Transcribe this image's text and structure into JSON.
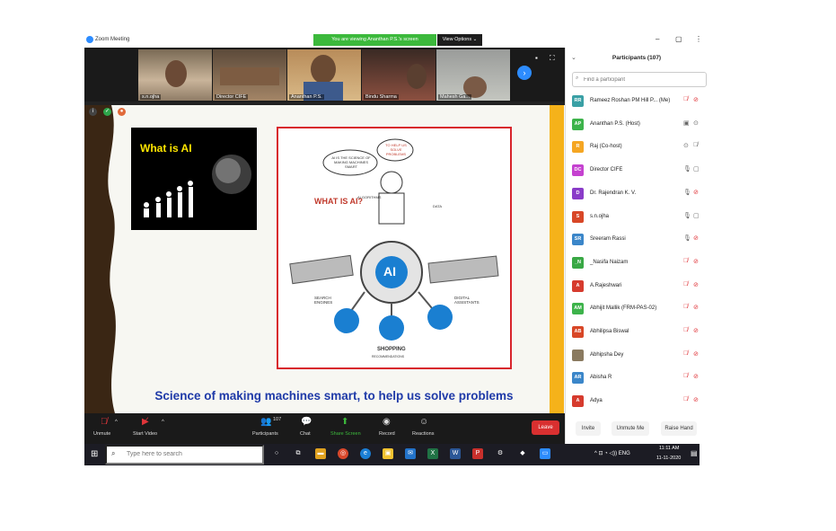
{
  "window": {
    "title": "Zoom Meeting",
    "viewing_banner": "You are viewing Ananthan P.S.'s screen",
    "view_options": "View Options ⌄",
    "controls": [
      "–",
      "▢",
      "⋮"
    ]
  },
  "video_strip": {
    "tiles": [
      {
        "name": "s.n.ojha"
      },
      {
        "name": "Director CIFE"
      },
      {
        "name": "Ananthan P.S."
      },
      {
        "name": "Bindu Sharma"
      },
      {
        "name": "Mahesh Ga..."
      }
    ]
  },
  "slide": {
    "heading_box": "What is AI",
    "illustration": {
      "chef_bubble_1": "AI IS THE SCIENCE OF MAKING MACHINES SMART",
      "chef_bubble_2": "TO HELP US SOLVE PROBLEMS",
      "what_is_ai": "WHAT IS AI?",
      "algorithms": "ALGORITHMS",
      "data": "DATA",
      "core": "AI",
      "search": "SEARCH ENGINES",
      "digital": "DIGITAL ASSISTANTS",
      "shopping": "SHOPPING",
      "shopping_sub": "RECOMMENDATIONS"
    },
    "caption": "Science of making machines smart, to help us solve problems"
  },
  "toolbar": {
    "unmute": "Unmute",
    "start_video": "Start Video",
    "participants": "Participants",
    "participants_count": "107",
    "chat": "Chat",
    "share_screen": "Share Screen",
    "record": "Record",
    "reactions": "Reactions",
    "leave": "Leave"
  },
  "panel": {
    "title": "Participants (107)",
    "search_placeholder": "Find a participant",
    "participants": [
      {
        "initials": "RR",
        "name": "Rameez Roshan PM Hill P... (Me)",
        "color": "#3aa0a5"
      },
      {
        "initials": "AP",
        "name": "Ananthan P.S. (Host)",
        "color": "#3db34b"
      },
      {
        "initials": "R",
        "name": "Raj (Co-host)",
        "color": "#f5a623"
      },
      {
        "initials": "DC",
        "name": "Director CIFE",
        "color": "#c542d0"
      },
      {
        "initials": "D",
        "name": "Dr. Rajendran K. V.",
        "color": "#8a3cc8"
      },
      {
        "initials": "S",
        "name": "s.n.ojha",
        "color": "#d84727"
      },
      {
        "initials": "SR",
        "name": "Sreeram Rassi",
        "color": "#3b86c9"
      },
      {
        "initials": "_N",
        "name": "_Nasifa Naizam",
        "color": "#39a845"
      },
      {
        "initials": "A",
        "name": "A.Rajeshwari",
        "color": "#d63b2e"
      },
      {
        "initials": "AM",
        "name": "Abhijit Mallik (FRM-PAS-02)",
        "color": "#3db34b"
      },
      {
        "initials": "AB",
        "name": "Abhilipsa Biswal",
        "color": "#d84727"
      },
      {
        "initials": "",
        "name": "Abhipsha Dey",
        "color": "#8a7a60"
      },
      {
        "initials": "AR",
        "name": "Abisha R",
        "color": "#3b86c9"
      },
      {
        "initials": "A",
        "name": "Adya",
        "color": "#d63b2e"
      }
    ],
    "invite": "Invite",
    "unmute_me": "Unmute Me",
    "raise_hand": "Raise Hand"
  },
  "taskbar": {
    "search_placeholder": "Type here to search",
    "tray": "^ ⊡ ◔ ◁)) ENG",
    "time": "11:11 AM",
    "date": "11-11-2020"
  },
  "colors": {
    "zoom_blue": "#2d8cff",
    "banner_green": "#3cb93c",
    "leave_red": "#d93030",
    "caption_blue": "#1f3aa8",
    "mic_off_red": "#e0353a"
  }
}
